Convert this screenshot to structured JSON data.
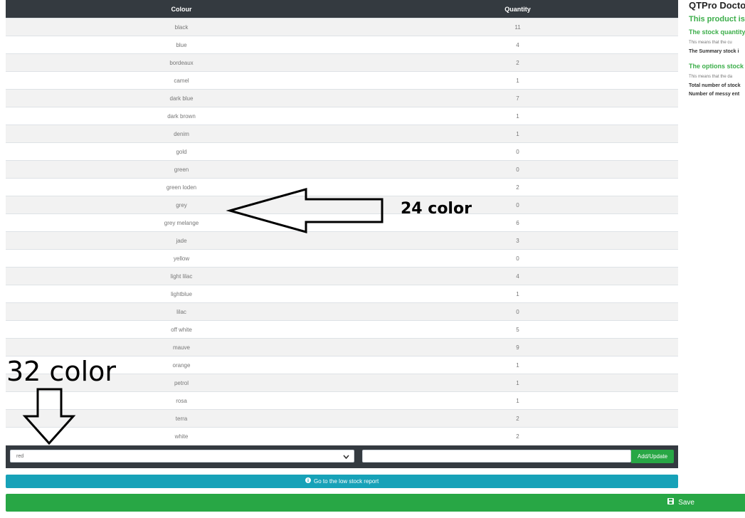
{
  "table": {
    "headers": {
      "colour": "Colour",
      "quantity": "Quantity"
    },
    "rows": [
      {
        "colour": "black",
        "quantity": "11"
      },
      {
        "colour": "blue",
        "quantity": "4"
      },
      {
        "colour": "bordeaux",
        "quantity": "2"
      },
      {
        "colour": "camel",
        "quantity": "1"
      },
      {
        "colour": "dark blue",
        "quantity": "7"
      },
      {
        "colour": "dark brown",
        "quantity": "1"
      },
      {
        "colour": "denim",
        "quantity": "1"
      },
      {
        "colour": "gold",
        "quantity": "0"
      },
      {
        "colour": "green",
        "quantity": "0"
      },
      {
        "colour": "green loden",
        "quantity": "2"
      },
      {
        "colour": "grey",
        "quantity": "0"
      },
      {
        "colour": "grey melange",
        "quantity": "6"
      },
      {
        "colour": "jade",
        "quantity": "3"
      },
      {
        "colour": "yellow",
        "quantity": "0"
      },
      {
        "colour": "light lilac",
        "quantity": "4"
      },
      {
        "colour": "lightblue",
        "quantity": "1"
      },
      {
        "colour": "lilac",
        "quantity": "0"
      },
      {
        "colour": "off white",
        "quantity": "5"
      },
      {
        "colour": "mauve",
        "quantity": "9"
      },
      {
        "colour": "orange",
        "quantity": "1"
      },
      {
        "colour": "petrol",
        "quantity": "1"
      },
      {
        "colour": "rosa",
        "quantity": "1"
      },
      {
        "colour": "terra",
        "quantity": "2"
      },
      {
        "colour": "white",
        "quantity": "2"
      }
    ]
  },
  "form": {
    "select_value": "red",
    "quantity_value": "",
    "add_update_label": "Add/Update"
  },
  "buttons": {
    "low_stock_label": "Go to the low stock report",
    "save_label": "Save"
  },
  "side_panel": {
    "title": "QTPro Doctor",
    "status_heading": "This product is",
    "stock_quantity_heading": "The stock quantity",
    "stock_quantity_text": "This means that the cu",
    "summary_text": "The Summary stock i",
    "options_heading": "The options stock",
    "options_text": "This means that the da",
    "total_text": "Total number of stock",
    "messy_text": "Number of messy ent"
  },
  "annotations": {
    "label_24": "24 color",
    "label_32": "32 color"
  },
  "icons": {
    "low_stock": "info-circle-icon",
    "save": "floppy-disk-icon",
    "select": "chevron-down-icon"
  },
  "colors": {
    "header_dark": "#343a40",
    "success": "#28a745",
    "info": "#17a2b8",
    "panel_green": "#3cae4a"
  }
}
